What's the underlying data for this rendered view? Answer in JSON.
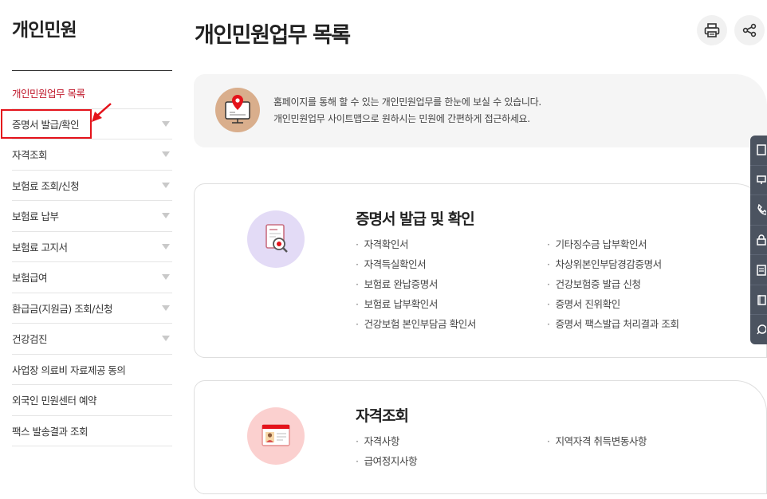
{
  "sidebar": {
    "title": "개인민원",
    "items": [
      {
        "label": "개인민원업무 목록",
        "active": true,
        "has_caret": false
      },
      {
        "label": "증명서 발급/확인",
        "active": false,
        "has_caret": true
      },
      {
        "label": "자격조회",
        "active": false,
        "has_caret": true
      },
      {
        "label": "보험료 조회/신청",
        "active": false,
        "has_caret": true
      },
      {
        "label": "보험료 납부",
        "active": false,
        "has_caret": true
      },
      {
        "label": "보험료 고지서",
        "active": false,
        "has_caret": true
      },
      {
        "label": "보험급여",
        "active": false,
        "has_caret": true
      },
      {
        "label": "환급금(지원금) 조회/신청",
        "active": false,
        "has_caret": true
      },
      {
        "label": "건강검진",
        "active": false,
        "has_caret": true
      },
      {
        "label": "사업장 의료비 자료제공 동의",
        "active": false,
        "has_caret": false
      },
      {
        "label": "외국인 민원센터 예약",
        "active": false,
        "has_caret": false
      },
      {
        "label": "팩스 발송결과 조회",
        "active": false,
        "has_caret": false
      }
    ]
  },
  "header": {
    "title": "개인민원업무 목록",
    "print_icon": "printer-icon",
    "share_icon": "share-icon"
  },
  "info": {
    "icon": "monitor-location-icon",
    "line1": "홈페이지를 통해 할 수 있는 개인민원업무를 한눈에 보실 수 있습니다.",
    "line2": "개인민원업무 사이트맵으로 원하시는 민원에 간편하게 접근하세요."
  },
  "cards": [
    {
      "title": "증명서 발급 및 확인",
      "icon": "certificate-search-icon",
      "links": [
        "자격확인서",
        "기타징수금 납부확인서",
        "자격득실확인서",
        "차상위본인부담경감증명서",
        "보험료 완납증명서",
        "건강보험증 발급 신청",
        "보험료 납부확인서",
        "증명서 진위확인",
        "건강보험 본인부담금 확인서",
        "증명서 팩스발급 처리결과 조회"
      ]
    },
    {
      "title": "자격조회",
      "icon": "id-card-icon",
      "links": [
        "자격사항",
        "지역자격 취득변동사항",
        "급여정지사항"
      ]
    }
  ],
  "quickbar": [
    "document-icon",
    "monitor-icon",
    "phone-icon",
    "lock-icon",
    "list-icon",
    "book-icon",
    "chat-icon"
  ],
  "colors": {
    "accent": "#c0182b",
    "highlight_box": "#e4131b",
    "info_icon_bg": "#d9ae8c",
    "cert_icon_bg": "#e3dbf6",
    "id_icon_bg": "#fbd0cf",
    "quickbar_bg": "#4b5360"
  }
}
